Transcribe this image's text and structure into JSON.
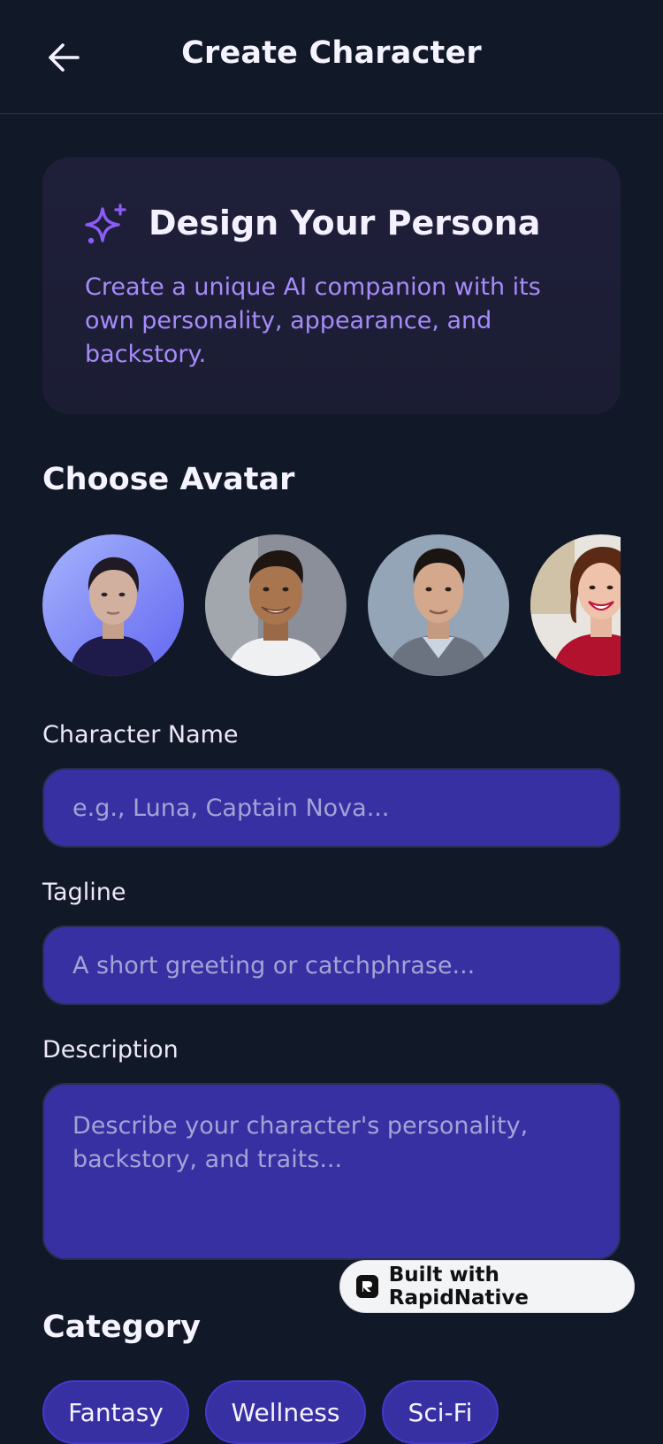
{
  "header": {
    "title": "Create Character",
    "back_icon": "arrow-left-icon"
  },
  "hero": {
    "icon": "sparkles-icon",
    "title": "Design Your Persona",
    "description": "Create a unique AI companion with its own personality, appearance, and backstory."
  },
  "avatars": {
    "title": "Choose Avatar",
    "items": [
      {
        "label": "avatar-woman-blue"
      },
      {
        "label": "avatar-man-smiling"
      },
      {
        "label": "avatar-man-sweater"
      },
      {
        "label": "avatar-woman-red"
      }
    ]
  },
  "form": {
    "name": {
      "label": "Character Name",
      "placeholder": "e.g., Luna, Captain Nova..."
    },
    "tagline": {
      "label": "Tagline",
      "placeholder": "A short greeting or catchphrase..."
    },
    "description": {
      "label": "Description",
      "placeholder": "Describe your character's personality, backstory, and traits..."
    }
  },
  "badge": {
    "label": "Built with RapidNative"
  },
  "category": {
    "title": "Category",
    "chips": [
      "Fantasy",
      "Wellness",
      "Sci-Fi"
    ]
  },
  "colors": {
    "background": "#111827",
    "card": "#1e1e38",
    "accent": "#a78bfa",
    "input_bg": "#3730a3"
  }
}
